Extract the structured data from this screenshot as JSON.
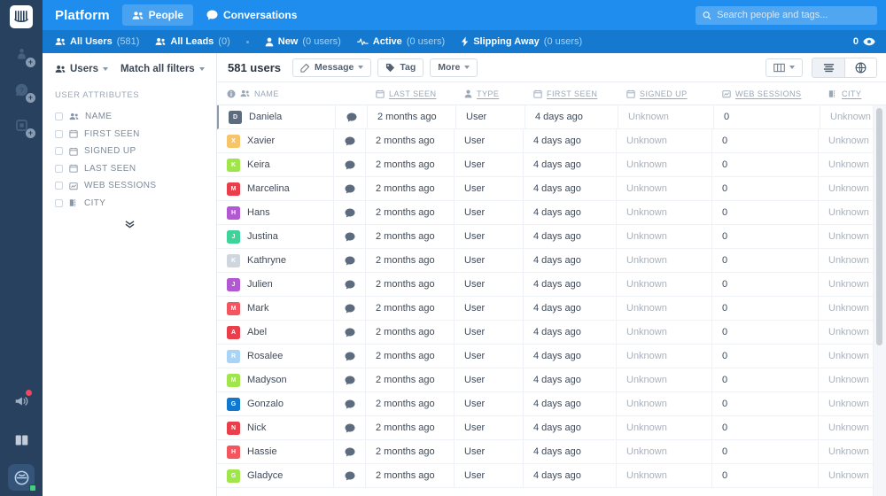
{
  "rail": {
    "logo_icon": "intercom-logo-icon",
    "items": [
      {
        "icon": "rocket-person-icon",
        "badge": "+"
      },
      {
        "icon": "question-bubble-icon",
        "badge": "+"
      },
      {
        "icon": "square-article-icon",
        "badge": "+"
      }
    ],
    "bottom": [
      {
        "icon": "megaphone-icon",
        "has_alert": true
      },
      {
        "icon": "book-icon",
        "has_alert": false
      }
    ],
    "avatar_icon": "user-avatar-icon"
  },
  "topbar": {
    "brand": "Platform",
    "nav": [
      {
        "label": "People",
        "icon": "people-icon",
        "active": true
      },
      {
        "label": "Conversations",
        "icon": "chat-bubble-icon",
        "active": false
      }
    ],
    "search": {
      "placeholder": "Search people and tags...",
      "value": "",
      "icon": "search-icon"
    }
  },
  "subnav": {
    "items": [
      {
        "label": "All Users",
        "count": "(581)",
        "icon": "people-icon"
      },
      {
        "label": "All Leads",
        "count": "(0)",
        "icon": "people-icon"
      },
      {
        "label": "New",
        "count": "(0 users)",
        "icon": "person-icon"
      },
      {
        "label": "Active",
        "count": "(0 users)",
        "icon": "pulse-icon"
      },
      {
        "label": "Slipping Away",
        "count": "(0 users)",
        "icon": "bolt-icon"
      }
    ],
    "watch_count": "0",
    "watch_icon": "eye-icon"
  },
  "filters": {
    "entity_label": "Users",
    "match_label": "Match all filters",
    "attributes_title": "USER ATTRIBUTES",
    "attributes": [
      {
        "label": "NAME",
        "icon": "people-icon",
        "checked": false
      },
      {
        "label": "FIRST SEEN",
        "icon": "calendar-icon",
        "checked": false
      },
      {
        "label": "SIGNED UP",
        "icon": "calendar-icon",
        "checked": false
      },
      {
        "label": "LAST SEEN",
        "icon": "calendar-icon",
        "checked": false
      },
      {
        "label": "WEB SESSIONS",
        "icon": "chart-icon",
        "checked": false
      },
      {
        "label": "CITY",
        "icon": "building-icon",
        "checked": false
      }
    ],
    "expand_icon": "double-chevron-down-icon"
  },
  "toolbar": {
    "count_label": "581 users",
    "message_label": "Message",
    "message_icon": "pencil-icon",
    "tag_label": "Tag",
    "tag_icon": "tag-icon",
    "more_label": "More",
    "columns_icon": "columns-icon",
    "list_view_icon": "list-icon",
    "globe_view_icon": "globe-icon"
  },
  "table": {
    "columns": [
      {
        "label": "NAME",
        "icon": "people-icon",
        "underline": false
      },
      {
        "label": "LAST SEEN",
        "icon": "calendar-icon",
        "underline": true
      },
      {
        "label": "TYPE",
        "icon": "person-icon",
        "underline": true
      },
      {
        "label": "FIRST SEEN",
        "icon": "calendar-icon",
        "underline": true
      },
      {
        "label": "SIGNED UP",
        "icon": "calendar-icon",
        "underline": true
      },
      {
        "label": "WEB SESSIONS",
        "icon": "chart-icon",
        "underline": true
      },
      {
        "label": "CITY",
        "icon": "building-icon",
        "underline": true
      }
    ],
    "info_icon": "info-icon",
    "chat_icon": "chat-bubble-icon",
    "rows": [
      {
        "name": "Daniela",
        "initial": "D",
        "color": "#5c6b7e",
        "last_seen": "2 months ago",
        "type": "User",
        "first_seen": "4 days ago",
        "signed_up": "Unknown",
        "web_sessions": "0",
        "city": "Unknown"
      },
      {
        "name": "Xavier",
        "initial": "X",
        "color": "#f7c469",
        "last_seen": "2 months ago",
        "type": "User",
        "first_seen": "4 days ago",
        "signed_up": "Unknown",
        "web_sessions": "0",
        "city": "Unknown"
      },
      {
        "name": "Keira",
        "initial": "K",
        "color": "#a0e54c",
        "last_seen": "2 months ago",
        "type": "User",
        "first_seen": "4 days ago",
        "signed_up": "Unknown",
        "web_sessions": "0",
        "city": "Unknown"
      },
      {
        "name": "Marcelina",
        "initial": "M",
        "color": "#ea3f4a",
        "last_seen": "2 months ago",
        "type": "User",
        "first_seen": "4 days ago",
        "signed_up": "Unknown",
        "web_sessions": "0",
        "city": "Unknown"
      },
      {
        "name": "Hans",
        "initial": "H",
        "color": "#b258d3",
        "last_seen": "2 months ago",
        "type": "User",
        "first_seen": "4 days ago",
        "signed_up": "Unknown",
        "web_sessions": "0",
        "city": "Unknown"
      },
      {
        "name": "Justina",
        "initial": "J",
        "color": "#3fd39a",
        "last_seen": "2 months ago",
        "type": "User",
        "first_seen": "4 days ago",
        "signed_up": "Unknown",
        "web_sessions": "0",
        "city": "Unknown"
      },
      {
        "name": "Kathryne",
        "initial": "K",
        "color": "#cfd6dd",
        "last_seen": "2 months ago",
        "type": "User",
        "first_seen": "4 days ago",
        "signed_up": "Unknown",
        "web_sessions": "0",
        "city": "Unknown"
      },
      {
        "name": "Julien",
        "initial": "J",
        "color": "#b258d3",
        "last_seen": "2 months ago",
        "type": "User",
        "first_seen": "4 days ago",
        "signed_up": "Unknown",
        "web_sessions": "0",
        "city": "Unknown"
      },
      {
        "name": "Mark",
        "initial": "M",
        "color": "#f4565f",
        "last_seen": "2 months ago",
        "type": "User",
        "first_seen": "4 days ago",
        "signed_up": "Unknown",
        "web_sessions": "0",
        "city": "Unknown"
      },
      {
        "name": "Abel",
        "initial": "A",
        "color": "#ea3f4a",
        "last_seen": "2 months ago",
        "type": "User",
        "first_seen": "4 days ago",
        "signed_up": "Unknown",
        "web_sessions": "0",
        "city": "Unknown"
      },
      {
        "name": "Rosalee",
        "initial": "R",
        "color": "#a9d4f5",
        "last_seen": "2 months ago",
        "type": "User",
        "first_seen": "4 days ago",
        "signed_up": "Unknown",
        "web_sessions": "0",
        "city": "Unknown"
      },
      {
        "name": "Madyson",
        "initial": "M",
        "color": "#a0e54c",
        "last_seen": "2 months ago",
        "type": "User",
        "first_seen": "4 days ago",
        "signed_up": "Unknown",
        "web_sessions": "0",
        "city": "Unknown"
      },
      {
        "name": "Gonzalo",
        "initial": "G",
        "color": "#1178cf",
        "last_seen": "2 months ago",
        "type": "User",
        "first_seen": "4 days ago",
        "signed_up": "Unknown",
        "web_sessions": "0",
        "city": "Unknown"
      },
      {
        "name": "Nick",
        "initial": "N",
        "color": "#ea3f4a",
        "last_seen": "2 months ago",
        "type": "User",
        "first_seen": "4 days ago",
        "signed_up": "Unknown",
        "web_sessions": "0",
        "city": "Unknown"
      },
      {
        "name": "Hassie",
        "initial": "H",
        "color": "#f4565f",
        "last_seen": "2 months ago",
        "type": "User",
        "first_seen": "4 days ago",
        "signed_up": "Unknown",
        "web_sessions": "0",
        "city": "Unknown"
      },
      {
        "name": "Gladyce",
        "initial": "G",
        "color": "#a0e54c",
        "last_seen": "2 months ago",
        "type": "User",
        "first_seen": "4 days ago",
        "signed_up": "Unknown",
        "web_sessions": "0",
        "city": "Unknown"
      }
    ]
  },
  "colors": {
    "brand_blue": "#1f8ded",
    "subnav_blue": "#1579cf",
    "rail_navy": "#27415e"
  }
}
